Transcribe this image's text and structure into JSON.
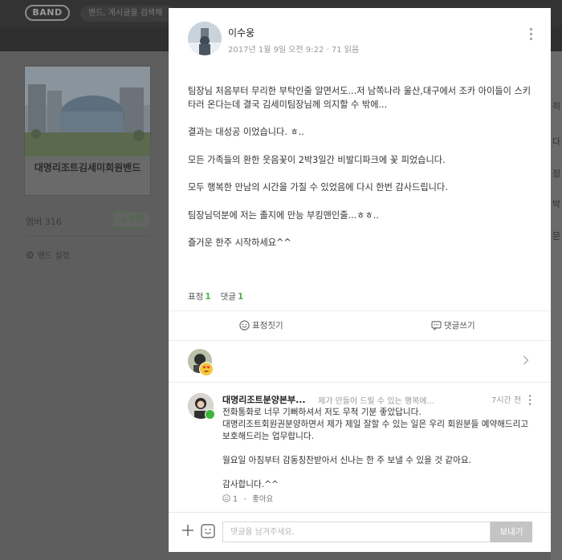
{
  "background": {
    "logo": "BAND",
    "search_placeholder": "밴드, 게시글을 검색해",
    "band_title": "대명리조트김세미회원밴드",
    "members_label": "멤버 316",
    "invite_label": "+ 초대",
    "settings_label": "밴드 설정",
    "right_column_glyphs": [
      "히",
      "다",
      "정",
      "박",
      "문"
    ]
  },
  "post": {
    "author": "이수웅",
    "date": "2017년 1월 9일 오전 9:22",
    "views": "71 읽음",
    "body": [
      "팀장님 처음부터 무리한 부탁인줄 알면서도...저 남쪽나라 울산,대구에서 조카 아이들이 스키타러 온다는데  결국 김세미팀장님께 의지할 수 밖에...",
      "",
      "결과는 대성공 이었습니다. ㅎ..",
      "",
      "모든 가족들의 환한 웃음꽃이 2박3일간 비발디파크에 꽃 피었습니다.",
      "",
      "모두 행복한 만남의 시간을 가질 수 있었음에 다시 한번 감사드립니다.",
      "",
      "팀장님덕분에 저는 졸지에 만능 부킹맨인줄...ㅎㅎ..",
      "",
      "즐거운 한주 시작하세요^^"
    ],
    "stats": {
      "reactions_label": "표정",
      "reactions_count": "1",
      "comments_label": "댓글",
      "comments_count": "1"
    },
    "actions": {
      "react_label": "표정짓기",
      "comment_label": "댓글쓰기"
    }
  },
  "comment": {
    "author": "대명리조트분양본부...",
    "preview": "제가 만들어 드릴 수 있는 행복에...",
    "time": "7시간 전",
    "body": [
      "전화통화로 너무 기뻐하셔서 저도 무척 기분 좋았답니다.",
      "대명리조트회원권분양하면서 제가 제일 잘할 수 있는 일은 우리 회원분들 예약해드리고 보호해드리는 업무랍니다.",
      "",
      "월요일 아침부터 감동칭찬받아서 신나는 한 주 보낼 수 있을 것 같아요.",
      "",
      "감사합니다.^^"
    ],
    "reaction_count": "1",
    "like_label": "좋아요"
  },
  "composer": {
    "placeholder": "댓글을 남겨주세요.",
    "send_label": "보내기"
  },
  "colors": {
    "accent_green": "#4db34d",
    "send_button_disabled": "#c4c4c4",
    "overlay_header": "#2f2f2f"
  }
}
